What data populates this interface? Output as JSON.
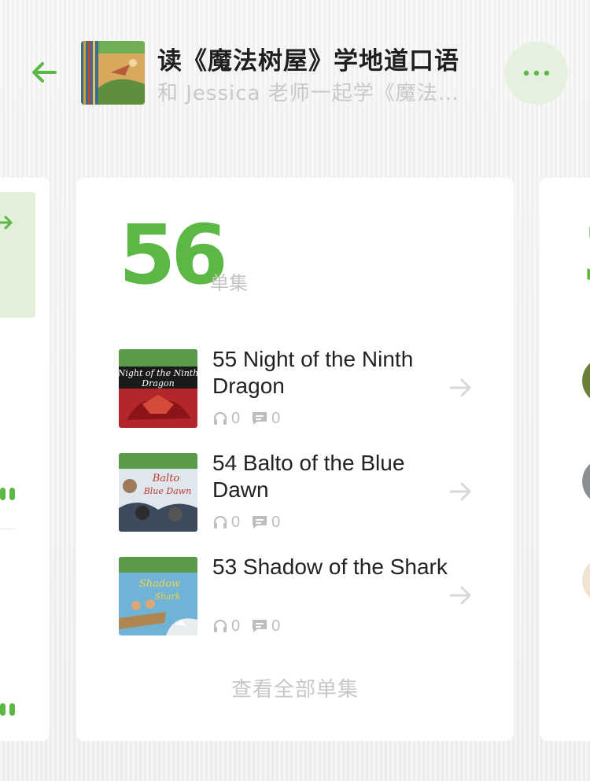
{
  "header": {
    "title": "读《魔法树屋》学地道口语",
    "subtitle": "和 Jessica 老师一起学《魔法…"
  },
  "main": {
    "count": "56",
    "count_unit": "单集",
    "episodes": [
      {
        "title": "55 Night of the Ninth Dragon",
        "plays": "0",
        "comments": "0"
      },
      {
        "title": "54 Balto of the Blue Dawn",
        "plays": "0",
        "comments": "0"
      },
      {
        "title": "53 Shadow of the Shark",
        "plays": "0",
        "comments": "0"
      }
    ],
    "view_all": "查看全部单集"
  },
  "colors": {
    "accent": "#5cb845",
    "accent_light": "#e6f0de",
    "title_text": "#1f1f1f",
    "muted_text": "#c4c4c4"
  },
  "icons": {
    "back": "arrow-left-icon",
    "more": "ellipsis-icon",
    "plays": "headphones-icon",
    "comments": "comment-icon",
    "episode_arrow": "arrow-right-icon"
  }
}
